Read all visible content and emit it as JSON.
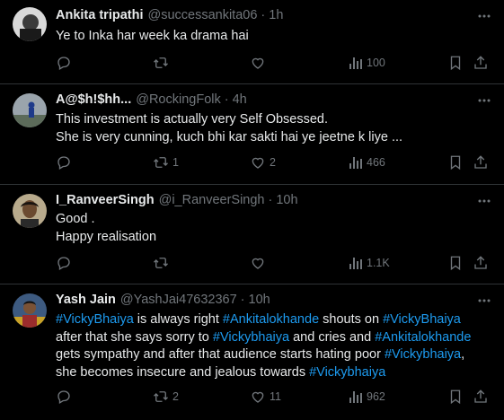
{
  "tweets": [
    {
      "name": "Ankita tripathi",
      "handle": "@successankita06",
      "time": "1h",
      "text": "Ye to Inka har week ka drama hai",
      "replies": "",
      "retweets": "",
      "likes": "",
      "views": "100"
    },
    {
      "name": "A@$h!$hh...",
      "handle": "@RockingFolk",
      "time": "4h",
      "text": "This investment is actually very Self  Obsessed.\nShe is very cunning, kuch bhi kar sakti hai ye jeetne k liye ...",
      "replies": "",
      "retweets": "1",
      "likes": "2",
      "views": "466"
    },
    {
      "name": "I_RanveerSingh",
      "handle": "@i_RanveerSingh",
      "time": "10h",
      "text": "Good .\nHappy realisation",
      "replies": "",
      "retweets": "",
      "likes": "",
      "views": "1.1K"
    },
    {
      "name": "Yash Jain",
      "handle": "@YashJai47632367",
      "time": "10h",
      "text_parts": [
        {
          "t": "#VickyBhaiya",
          "tag": true
        },
        {
          "t": " is always right ",
          "tag": false
        },
        {
          "t": "#Ankitalokhande",
          "tag": true
        },
        {
          "t": " shouts on ",
          "tag": false
        },
        {
          "t": "#VickyBhaiya",
          "tag": true
        },
        {
          "t": "\nafter that she says sorry to ",
          "tag": false
        },
        {
          "t": "#Vickybhaiya",
          "tag": true
        },
        {
          "t": " and cries and ",
          "tag": false
        },
        {
          "t": "#Ankitalokhande",
          "tag": true
        },
        {
          "t": "\ngets sympathy and after that audience starts hating poor ",
          "tag": false
        },
        {
          "t": "#Vickybhaiya",
          "tag": true
        },
        {
          "t": ",\nshe becomes insecure and jealous towards ",
          "tag": false
        },
        {
          "t": "#Vickybhaiya",
          "tag": true
        }
      ],
      "replies": "",
      "retweets": "2",
      "likes": "11",
      "views": "962"
    }
  ],
  "icons": {
    "reply": "reply-icon",
    "retweet": "retweet-icon",
    "like": "heart-icon",
    "views": "views-icon",
    "bookmark": "bookmark-icon",
    "share": "share-icon",
    "more": "more-icon"
  },
  "colors": {
    "background": "#000000",
    "text": "#e7e9ea",
    "muted": "#71767b",
    "hashtag": "#1d9bf0",
    "divider": "#2f3336"
  }
}
